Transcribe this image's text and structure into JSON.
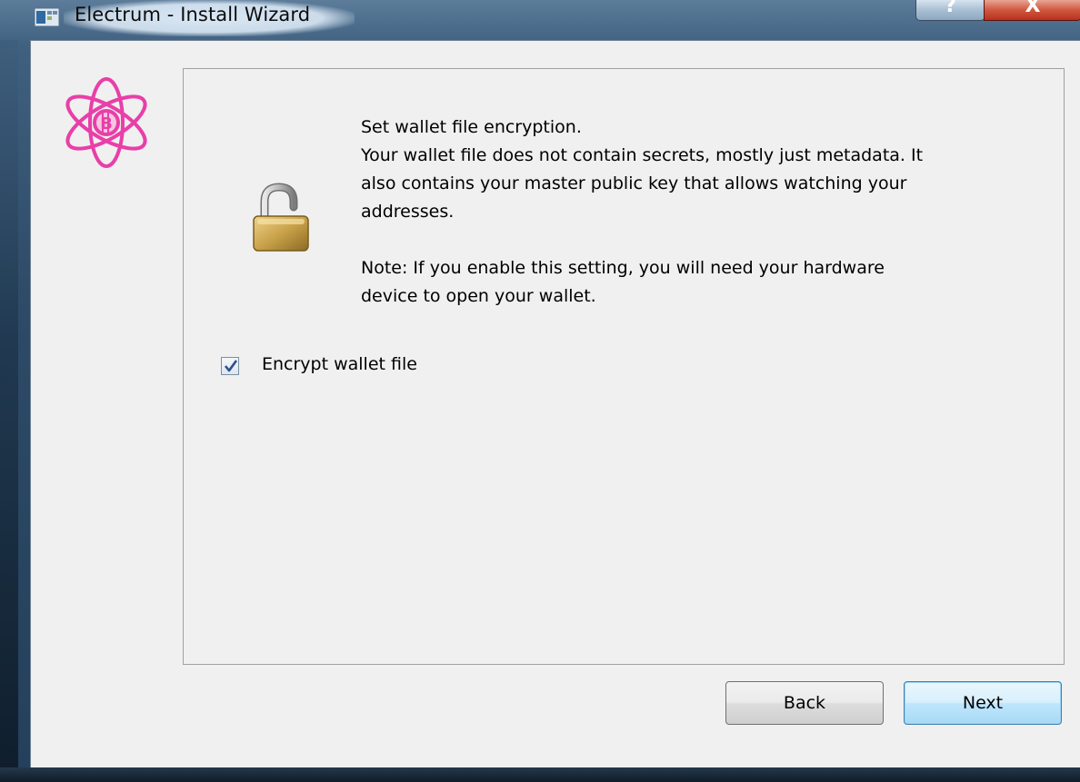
{
  "window": {
    "title": "Electrum  -  Install Wizard",
    "help_label": "?",
    "close_label": "X"
  },
  "message": {
    "line1": "Set wallet file encryption.",
    "line2": "Your wallet file does not contain secrets, mostly just metadata. It",
    "line3": "also contains your master public key that allows watching your",
    "line4": "addresses.",
    "line5": "Note: If you enable this setting, you will need your hardware",
    "line6": "device to open your wallet."
  },
  "checkbox": {
    "label": "Encrypt wallet file",
    "checked": true
  },
  "buttons": {
    "back": "Back",
    "next": "Next"
  },
  "colors": {
    "logo_accent": "#e83fa8",
    "next_button_border": "#3c7fb1",
    "lock_body": "#c9a24a"
  },
  "icons": {
    "app": "electrum-app-icon",
    "logo": "electrum-logo-icon",
    "lock": "open-padlock-icon"
  }
}
